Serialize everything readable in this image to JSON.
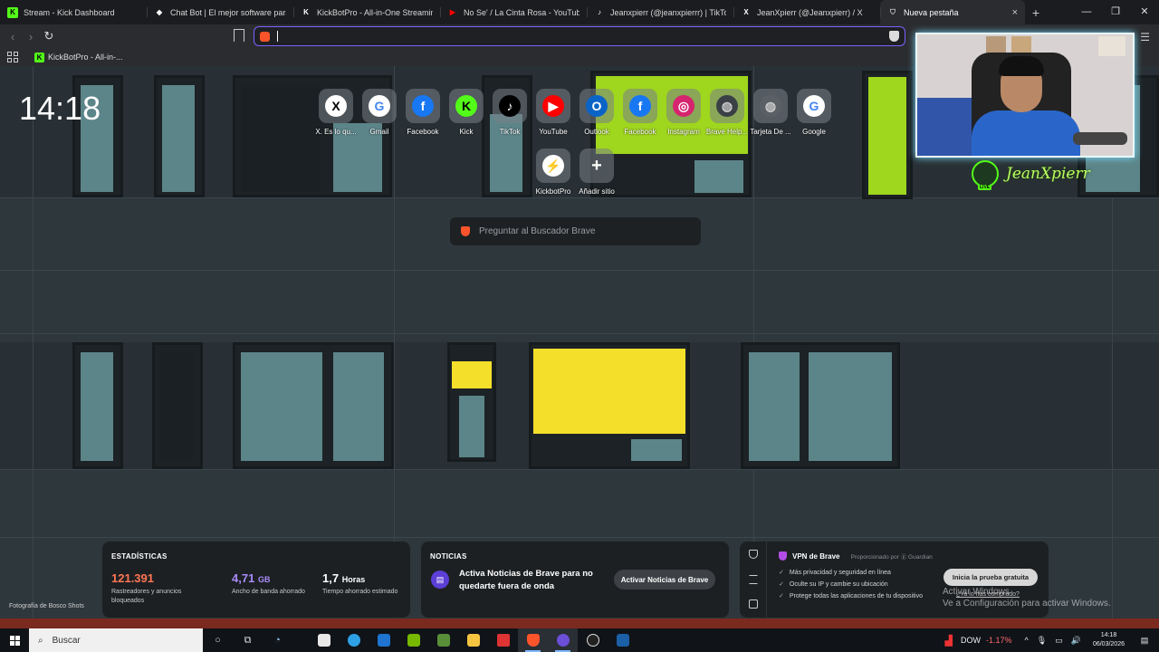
{
  "browser": {
    "tabs": [
      {
        "title": "Stream - Kick Dashboard",
        "icon": "kick-icon",
        "color": "#53fc18"
      },
      {
        "title": "Chat Bot | El mejor software para pot",
        "icon": "diamond-icon",
        "color": "#ffffff"
      },
      {
        "title": "KickBotPro - All-in-One Streaming To",
        "icon": "kickbot-icon",
        "color": "#ffffff"
      },
      {
        "title": "No Se' / La Cinta Rosa - YouTube",
        "icon": "youtube-icon",
        "color": "#ff0000"
      },
      {
        "title": "Jeanxpierr (@jeanxpierrr) | TikTok",
        "icon": "tiktok-icon",
        "color": "#ffffff"
      },
      {
        "title": "JeanXpierr (@Jeanxpierr) / X",
        "icon": "x-icon",
        "color": "#ffffff"
      },
      {
        "title": "Nueva pestaña",
        "icon": "brave-icon",
        "color": "#cccccc",
        "active": true
      }
    ],
    "new_tab_symbol": "+",
    "window_controls": {
      "minimize": "—",
      "maximize": "❐",
      "close": "✕"
    },
    "url": "",
    "bookmarks": [
      {
        "label": "KickBotPro - All-in-..."
      }
    ]
  },
  "newtab": {
    "clock": "14:18",
    "top_sites": [
      {
        "label": "X. Es lo qu...",
        "icon": "x-icon",
        "glyph": "X",
        "bg": "#ffffff",
        "fg": "#000000"
      },
      {
        "label": "Gmail",
        "icon": "google-icon",
        "glyph": "G",
        "bg": "#ffffff",
        "fg": "#4285f4"
      },
      {
        "label": "Facebook",
        "icon": "facebook-icon",
        "glyph": "f",
        "bg": "#1877f2",
        "fg": "#ffffff"
      },
      {
        "label": "Kick",
        "icon": "kick-icon",
        "glyph": "K",
        "bg": "#53fc18",
        "fg": "#000000"
      },
      {
        "label": "TikTok",
        "icon": "tiktok-icon",
        "glyph": "♪",
        "bg": "#000000",
        "fg": "#ffffff"
      },
      {
        "label": "YouTube",
        "icon": "youtube-icon",
        "glyph": "▶",
        "bg": "#ff0000",
        "fg": "#ffffff"
      },
      {
        "label": "Outlook",
        "icon": "outlook-icon",
        "glyph": "O",
        "bg": "#0a64c8",
        "fg": "#ffffff"
      },
      {
        "label": "Facebook",
        "icon": "facebook-icon",
        "glyph": "f",
        "bg": "#1877f2",
        "fg": "#ffffff"
      },
      {
        "label": "Instagram",
        "icon": "instagram-icon",
        "glyph": "◎",
        "bg": "#d6246e",
        "fg": "#ffffff"
      },
      {
        "label": "Brave Help...",
        "icon": "globe-icon",
        "glyph": "◍",
        "bg": "#3a4046",
        "fg": "#cccccc"
      },
      {
        "label": "Tarjeta De ...",
        "icon": "globe-icon",
        "glyph": "◍",
        "bg": "#5a6066",
        "fg": "#cccccc"
      },
      {
        "label": "Google",
        "icon": "google-icon",
        "glyph": "G",
        "bg": "#ffffff",
        "fg": "#4285f4"
      },
      {
        "label": "KickbotPro",
        "icon": "kickbot-icon",
        "glyph": "⚡",
        "bg": "#ffffff",
        "fg": "#222222"
      },
      {
        "label": "Añadir sitio",
        "icon": "plus-icon",
        "glyph": "+",
        "bg": "transparent",
        "fg": "#ffffff"
      }
    ],
    "search_placeholder": "Preguntar al Buscador Brave",
    "photo_credit": "Fotografía de Bosco Shots"
  },
  "overlay": {
    "streamer_name": "JeanXpierr",
    "live_badge": "LIVE"
  },
  "widgets": {
    "stats": {
      "title": "ESTADÍSTICAS",
      "items": [
        {
          "value": "121.391",
          "unit": "",
          "desc": "Rastreadores y anuncios bloqueados",
          "color": "#ff7654"
        },
        {
          "value": "4,71",
          "unit": "GB",
          "desc": "Ancho de banda ahorrado",
          "color": "#a78bfa"
        },
        {
          "value": "1,7",
          "unit": "Horas",
          "desc": "Tiempo ahorrado estimado",
          "color": "#ffffff"
        }
      ]
    },
    "news": {
      "title": "NOTICIAS",
      "text": "Activa Noticias de Brave para no quedarte fuera de onda",
      "button": "Activar Noticias de Brave"
    },
    "vpn": {
      "title": "VPN de Brave",
      "provider": "Proporcionado por ⓖ Guardian",
      "features": [
        "Más privacidad y seguridad en línea",
        "Oculte su IP y cambie su ubicación",
        "Protege todas las aplicaciones de tu dispositivo"
      ],
      "button": "Inicia la prueba gratuita",
      "link": "¿Ya lo has comprado?"
    }
  },
  "windows": {
    "activate_line1": "Activar Windows",
    "activate_line2": "Ve a Configuración para activar Windows.",
    "search_label": "Buscar",
    "ticker": "DOW",
    "ticker_change": "-1.17%",
    "time": "14:18",
    "date": "06/03/2026"
  }
}
